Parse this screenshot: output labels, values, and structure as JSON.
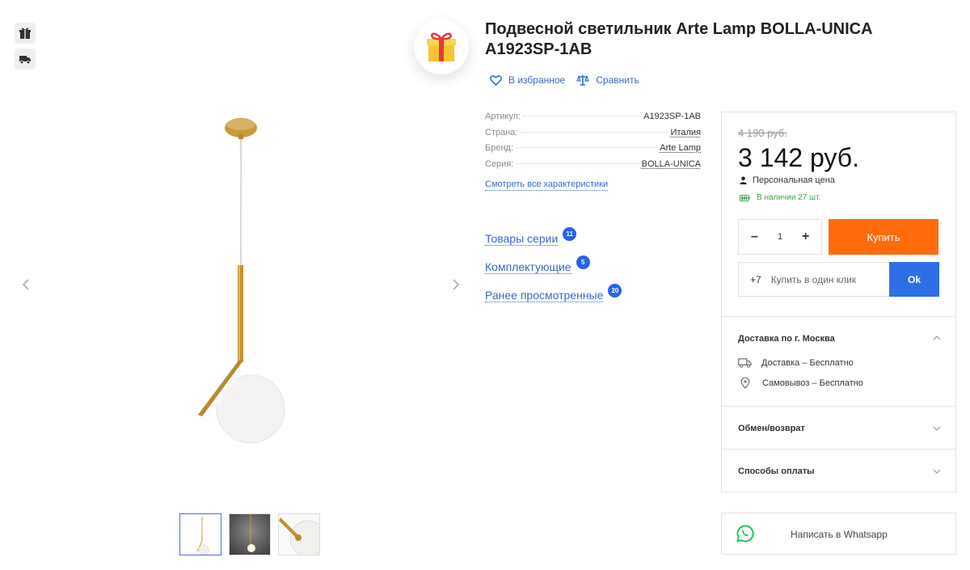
{
  "product": {
    "title": "Подвесной светильник Arte Lamp BOLLA-UNICA A1923SP-1AB"
  },
  "actions": {
    "favorite": "В избранное",
    "compare": "Сравнить"
  },
  "specs": [
    {
      "label": "Артикул:",
      "value": "A1923SP-1AB"
    },
    {
      "label": "Страна:",
      "value": "Италия"
    },
    {
      "label": "Бренд:",
      "value": "Arte Lamp"
    },
    {
      "label": "Серия:",
      "value": "BOLLA-UNICA"
    }
  ],
  "all_specs_link": "Смотреть все характеристики",
  "series_links": [
    {
      "label": "Товары серии",
      "count": "11"
    },
    {
      "label": "Комплектующие",
      "count": "5"
    },
    {
      "label": "Ранее просмотренные",
      "count": "20"
    }
  ],
  "price": {
    "old": "4 190 руб.",
    "current": "3 142 руб.",
    "personal": "Персональная цена",
    "stock": "В наличии 27 шт."
  },
  "purchase": {
    "qty": "1",
    "minus": "–",
    "plus": "+",
    "buy": "Купить",
    "phone_prefix": "+7",
    "phone_placeholder": "Купить в один клик",
    "ok": "Ok"
  },
  "delivery": {
    "title": "Доставка по г. Москва",
    "items": [
      {
        "icon": "truck-icon",
        "text": "Доставка – Бесплатно"
      },
      {
        "icon": "pin-icon",
        "text": "Самовывоз – Бесплатно"
      }
    ]
  },
  "exchange": "Обмен/возврат",
  "payment": "Способы оплаты",
  "whatsapp": "Написать в Whatsapp",
  "colors": {
    "accent": "#2f6fe6",
    "buy": "#ff6b0a",
    "stock": "#3fa34d",
    "whatsapp": "#25c35a"
  }
}
